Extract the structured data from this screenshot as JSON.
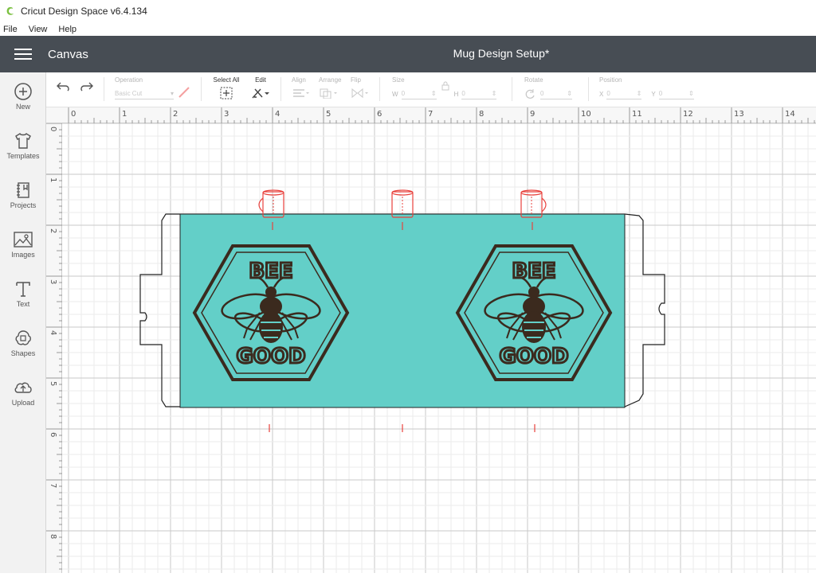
{
  "window": {
    "title": "Cricut Design Space  v6.4.134"
  },
  "menu": [
    "File",
    "View",
    "Help"
  ],
  "header": {
    "section": "Canvas",
    "project_title": "Mug Design Setup*"
  },
  "sidebar": {
    "items": [
      {
        "label": "New",
        "icon": "plus-circle-icon"
      },
      {
        "label": "Templates",
        "icon": "tshirt-icon"
      },
      {
        "label": "Projects",
        "icon": "notebook-icon"
      },
      {
        "label": "Images",
        "icon": "image-icon"
      },
      {
        "label": "Text",
        "icon": "text-t-icon"
      },
      {
        "label": "Shapes",
        "icon": "shapes-icon"
      },
      {
        "label": "Upload",
        "icon": "cloud-upload-icon"
      }
    ]
  },
  "toolbar": {
    "operation_label": "Operation",
    "operation_value": "Basic Cut",
    "select_all_label": "Select All",
    "edit_label": "Edit",
    "align_label": "Align",
    "arrange_label": "Arrange",
    "flip_label": "Flip",
    "size_label": "Size",
    "w_label": "W",
    "w_value": "0",
    "h_label": "H",
    "h_value": "0",
    "rotate_label": "Rotate",
    "rotate_value": "0",
    "position_label": "Position",
    "x_label": "X",
    "x_value": "0",
    "y_label": "Y",
    "y_value": "0"
  },
  "rulers": {
    "top": [
      "0",
      "1",
      "2",
      "3",
      "4",
      "5",
      "6",
      "7",
      "8",
      "9",
      "10",
      "11",
      "12",
      "13",
      "14"
    ],
    "left": [
      "0",
      "1",
      "2",
      "3",
      "4",
      "5",
      "6",
      "7",
      "8"
    ]
  },
  "design": {
    "left_text_top": "BEE",
    "left_text_bottom": "GOOD",
    "right_text_top": "BEE",
    "right_text_bottom": "GOOD",
    "panel_color": "#63cfc8",
    "ink_color": "#3b2a1e",
    "guide_color": "#e8413c"
  }
}
